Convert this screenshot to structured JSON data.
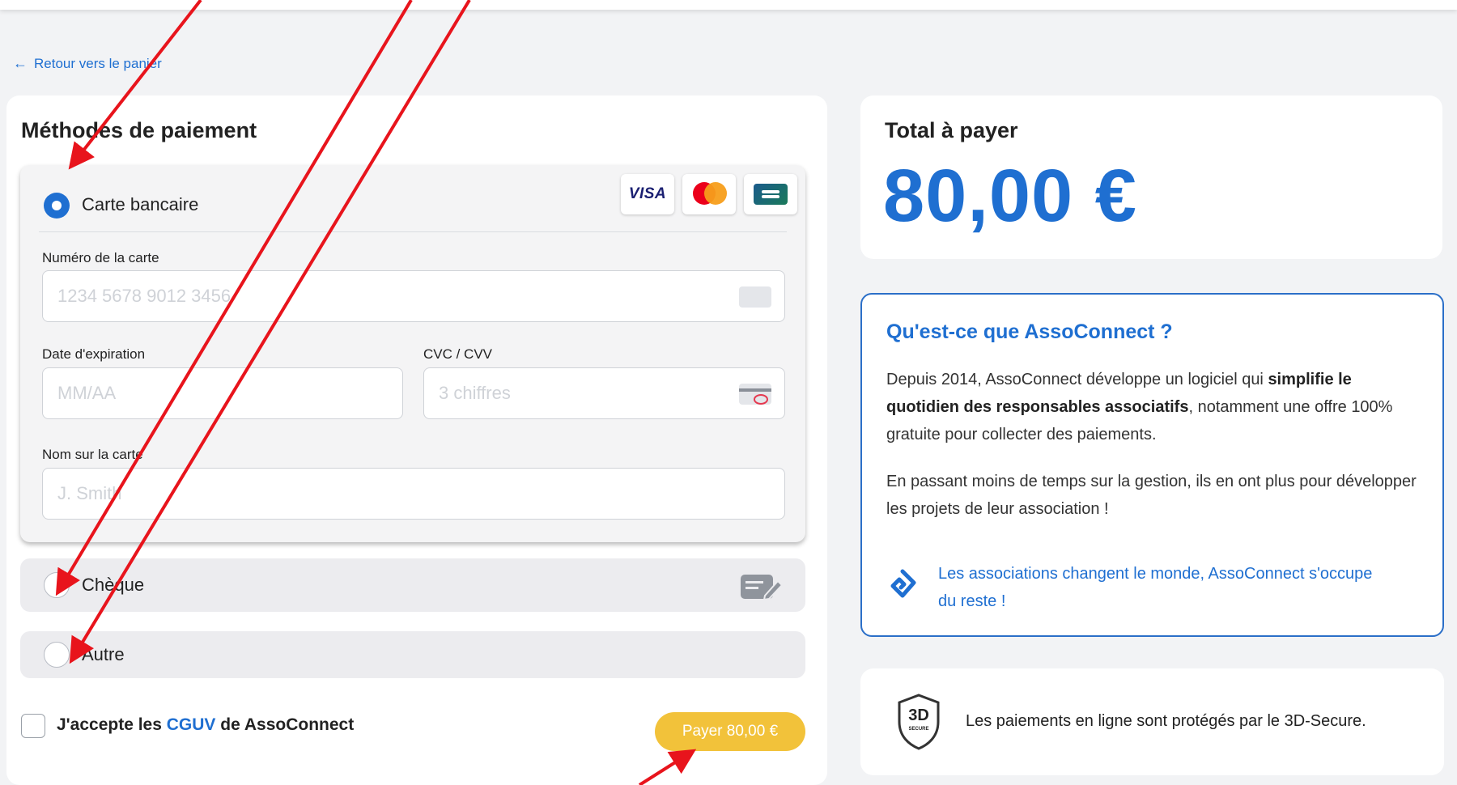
{
  "nav": {
    "back_label": "Retour vers le panier"
  },
  "payment": {
    "title": "Méthodes de paiement",
    "methods": [
      {
        "label": "Carte bancaire",
        "selected": true
      },
      {
        "label": "Chèque",
        "selected": false
      },
      {
        "label": "Autre",
        "selected": false
      }
    ],
    "card_logos": [
      "visa-logo",
      "mastercard-logo",
      "cb-logo"
    ],
    "visa_text": "VISA",
    "fields": {
      "card_number": {
        "label": "Numéro de la carte",
        "placeholder": "1234 5678 9012 3456"
      },
      "expiry": {
        "label": "Date d'expiration",
        "placeholder": "MM/AA"
      },
      "cvc": {
        "label": "CVC / CVV",
        "placeholder": "3 chiffres"
      },
      "name": {
        "label": "Nom sur la carte",
        "placeholder": "J. Smith"
      }
    },
    "accept": {
      "prefix": "J'accepte les ",
      "link": "CGUV",
      "suffix": " de AssoConnect",
      "checked": false
    },
    "pay_button": "Payer 80,00 €"
  },
  "summary": {
    "total_label": "Total à payer",
    "total_amount": "80,00 €"
  },
  "info": {
    "title": "Qu'est-ce que AssoConnect ?",
    "para1_before": "Depuis 2014, AssoConnect développe un logiciel qui ",
    "para1_bold": "simplifie le quotidien des responsables associatifs",
    "para1_after": ", notamment une offre 100% gratuite pour collecter des paiements.",
    "para2": "En passant moins de temps sur la gestion, ils en ont plus pour développer les projets de leur association !",
    "link": "Les associations changent le monde, AssoConnect s'occupe du reste !"
  },
  "secure": {
    "badge_text": "3D",
    "badge_subtext": "SECURE",
    "text": "Les paiements en ligne sont protégés par le 3D-Secure."
  },
  "colors": {
    "accent": "#1f6fd1",
    "pay_button": "#f2c23a",
    "annotation": "#e8141c",
    "background": "#f2f3f5"
  }
}
